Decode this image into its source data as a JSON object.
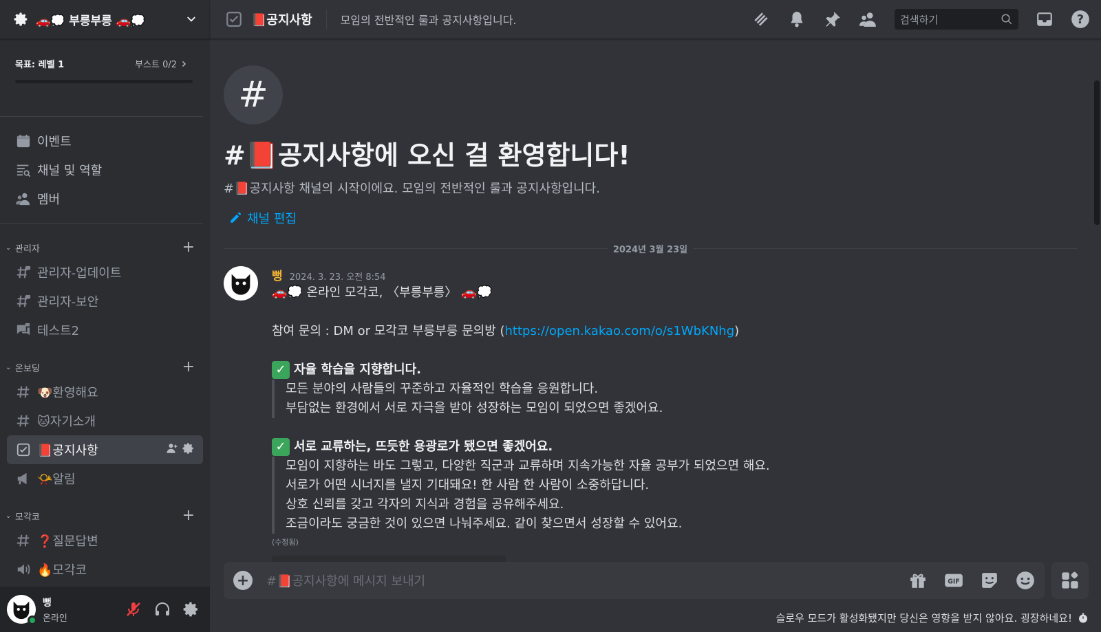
{
  "server": {
    "name": "🚗💭 부릉부릉 🚗💭"
  },
  "boost": {
    "goal": "목표: 레벨 1",
    "count": "부스트 0/2",
    "progress": 0.0
  },
  "nav": [
    {
      "label": "이벤트",
      "icon": "calendar-icon"
    },
    {
      "label": "채널 및 역할",
      "icon": "channel-browse-icon"
    },
    {
      "label": "멤버",
      "icon": "members-icon"
    }
  ],
  "categories": [
    {
      "name": "관리자",
      "channels": [
        {
          "label": "관리자-업데이트",
          "icon": "locked-hash-icon"
        },
        {
          "label": "관리자-보안",
          "icon": "locked-hash-icon"
        },
        {
          "label": "테스트2",
          "icon": "locked-forum-icon"
        }
      ]
    },
    {
      "name": "온보딩",
      "channels": [
        {
          "label": "🐶환영해요",
          "icon": "hash-icon"
        },
        {
          "label": "🐱자기소개",
          "icon": "hash-icon"
        },
        {
          "label": "📕공지사항",
          "icon": "rules-icon",
          "active": true
        },
        {
          "label": "📯알림",
          "icon": "announcement-icon"
        }
      ]
    },
    {
      "name": "모각코",
      "channels": [
        {
          "label": "❓질문답변",
          "icon": "hash-icon"
        },
        {
          "label": "🔥모각코",
          "icon": "voice-icon"
        }
      ]
    }
  ],
  "user": {
    "name": "뻥",
    "status": "온라인"
  },
  "header": {
    "channel": "📕공지사항",
    "topic": "모임의 전반적인 룰과 공지사항입니다.",
    "search_placeholder": "검색하기"
  },
  "welcome": {
    "title": "#📕공지사항에 오신 걸 환영합니다!",
    "subtitle": "#📕공지사항 채널의 시작이에요. 모임의 전반적인 룰과 공지사항입니다.",
    "edit": "채널 편집"
  },
  "date_divider": "2024년 3월 23일",
  "message": {
    "author": "뻥",
    "time": "2024. 3. 23. 오전 8:54",
    "line1": "🚗💭 온라인 모각코, 〈부릉부릉〉 🚗💭",
    "inquiry_prefix": "참여 문의 : DM or 모각코 부릉부릉 문의방 (",
    "inquiry_link": "https://open.kakao.com/o/s1WbKNhg",
    "inquiry_suffix": ")",
    "section1_title": "자율 학습을 지향합니다.",
    "section1_lines": [
      "모든 분야의 사람들의 꾸준하고 자율적인 학습을 응원합니다.",
      "부담없는 환경에서 서로 자극을 받아 성장하는 모임이 되었으면 좋겠어요."
    ],
    "section2_title": "서로 교류하는, 뜨듯한 용광로가 됐으면 좋겠어요.",
    "section2_lines": [
      "모임이 지향하는 바도 그렇고, 다양한 직군과 교류하며 지속가능한 자율 공부가 되었으면 해요.",
      "서로가 어떤 시너지를 낼지 기대돼요! 한 사람 한 사람이 소중하답니다.",
      "상호 신뢰를 갖고 각자의 지식과 경험을 공유해주세요.",
      "조금이라도 궁금한 것이 있으면 나눠주세요. 같이 찾으면서 성장할 수 있어요."
    ],
    "edited": "(수정됨)"
  },
  "composer": {
    "placeholder": "#📕공지사항에 메시지 보내기"
  },
  "slowmode": "슬로우 모드가 활성화됐지만 당신은 영향을 받지 않아요. 굉장하네요!",
  "colors": {
    "accent": "#00a8fc",
    "author": "#f0b232",
    "online": "#23a55a",
    "check": "#3ba55c"
  }
}
